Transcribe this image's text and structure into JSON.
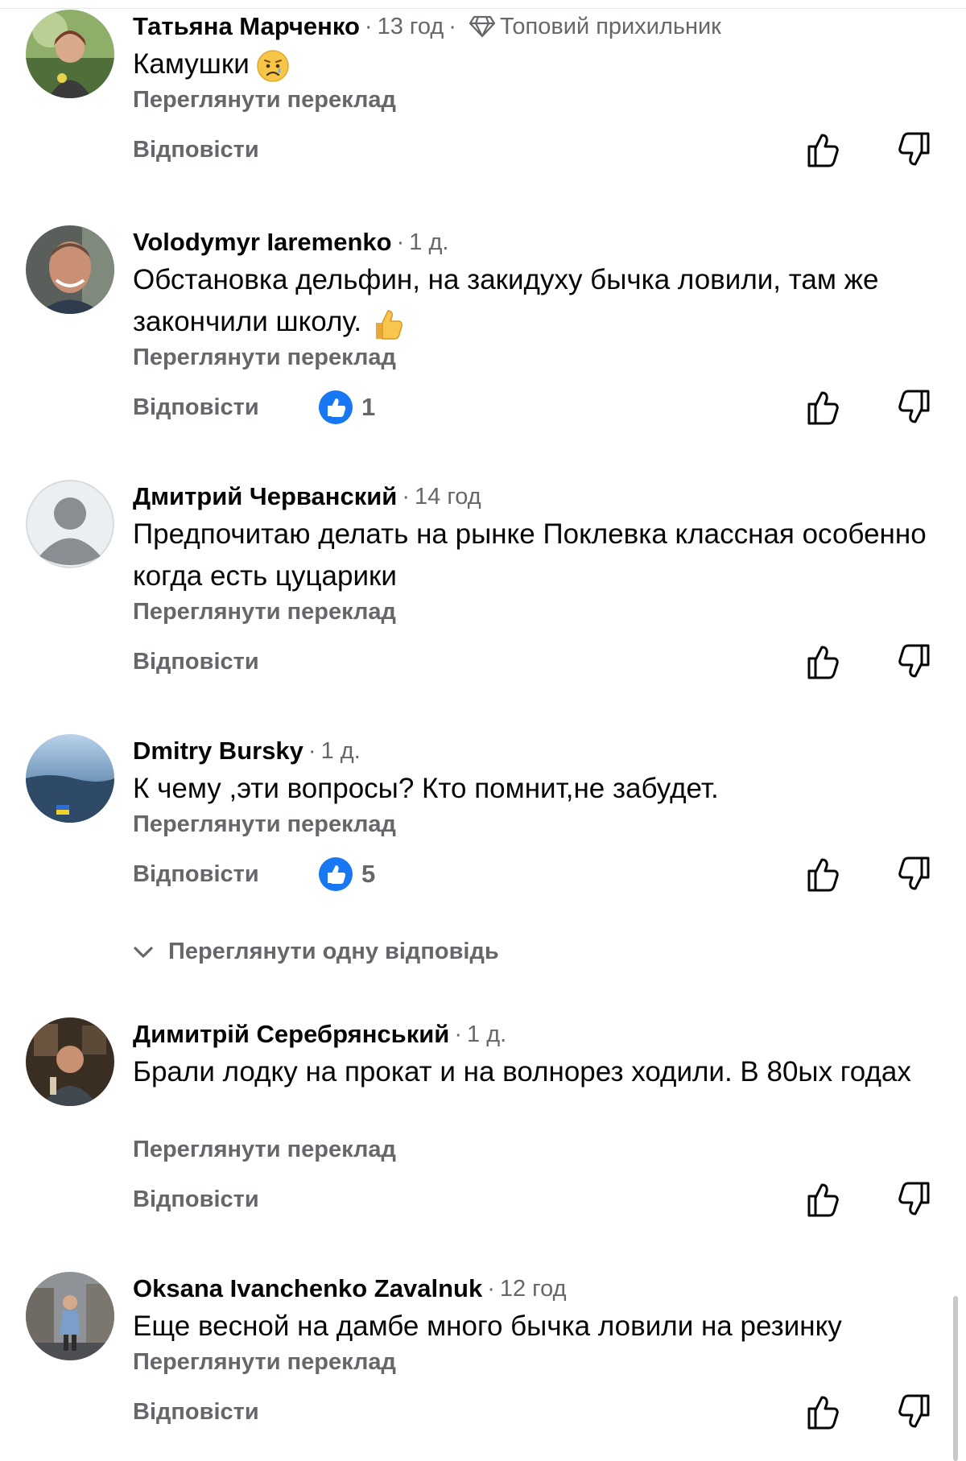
{
  "comments": [
    {
      "author": "Татьяна Марченко",
      "time": "13 год",
      "badge": "Топовий прихильник",
      "text": "Камушки",
      "emoji": "sad-face",
      "translate": "Переглянути переклад",
      "reply": "Відповісти",
      "likes": null
    },
    {
      "author": "Volodymyr Iaremenko",
      "time": "1 д.",
      "text": "Обстановка дельфин, на закидуху бычка ловили, там же закончили школу.",
      "emoji": "thumbs-up",
      "translate": "Переглянути переклад",
      "reply": "Відповісти",
      "likes": "1"
    },
    {
      "author": "Дмитрий Черванский",
      "time": "14 год",
      "text": "Предпочитаю делать на рынке Поклевка классная особенно когда есть цуцарики",
      "translate": "Переглянути переклад",
      "reply": "Відповісти",
      "likes": null
    },
    {
      "author": "Dmitry Bursky",
      "time": "1 д.",
      "text": "К чему ,эти вопросы? Кто помнит,не забудет.",
      "translate": "Переглянути переклад",
      "reply": "Відповісти",
      "likes": "5"
    },
    {
      "author": "Димитрій Серебрянський",
      "time": "1 д.",
      "text": "Брали лодку на прокат и на волнорез ходили. В 80ых годах",
      "translate": "Переглянути переклад",
      "reply": "Відповісти",
      "likes": null
    },
    {
      "author": "Oksana Ivanchenko Zavalnuk",
      "time": "12 год",
      "text": "Еще весной на дамбе много бычка ловили на резинку",
      "translate": "Переглянути переклад",
      "reply": "Відповісти",
      "likes": null
    }
  ],
  "view_replies": "Переглянути одну відповідь",
  "separator": "·",
  "colors": {
    "muted": "#65676b",
    "text": "#050505",
    "accent": "#1877f2"
  },
  "icons": [
    "diamond-icon",
    "like-reaction-icon",
    "thumbs-up-icon",
    "thumbs-down-icon",
    "chevron-down-icon"
  ]
}
